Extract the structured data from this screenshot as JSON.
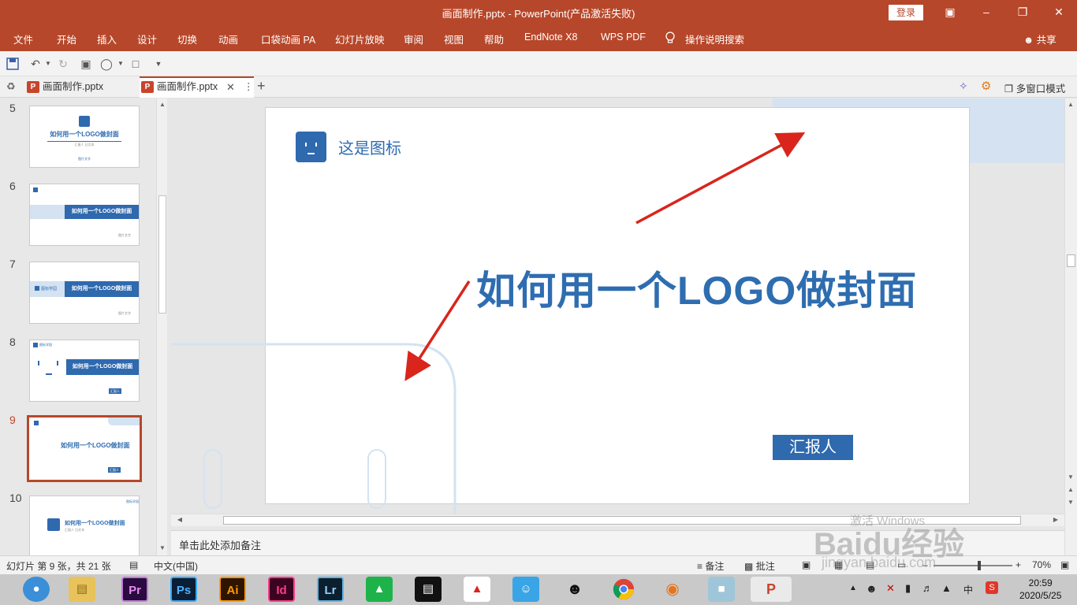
{
  "window": {
    "title": "画面制作.pptx  -  PowerPoint(产品激活失败)",
    "login": "登录"
  },
  "ribbon": {
    "tabs": [
      "文件",
      "开始",
      "插入",
      "设计",
      "切换",
      "动画",
      "口袋动画 PA",
      "幻灯片放映",
      "审阅",
      "视图",
      "帮助",
      "EndNote X8",
      "WPS PDF"
    ],
    "search": "操作说明搜索",
    "share": "共享"
  },
  "doc_tabs": {
    "tab1": "画面制作.pptx",
    "tab2": "画面制作.pptx",
    "multi_window": "多窗口模式"
  },
  "thumbnails": [
    {
      "num": "5",
      "title": "如何用一个LOGO做封面",
      "sub": "汇报人  日文本",
      "foot": "图片文字"
    },
    {
      "num": "6",
      "title": "如何用一个LOGO做封面",
      "sub": "",
      "foot": "图片文字"
    },
    {
      "num": "7",
      "title": "如何用一个LOGO做封面",
      "sub": "图标学园",
      "foot": "图片文字"
    },
    {
      "num": "8",
      "title": "如何用一个LOGO做封面",
      "sub": "图标学园",
      "foot": "汇报人"
    },
    {
      "num": "9",
      "title": "如何用一个LOGO做封面",
      "sub": "",
      "foot": "汇报人"
    },
    {
      "num": "10",
      "title": "如何用一个LOGO做封面",
      "sub": "汇报人  日文本",
      "foot": "图标学园"
    }
  ],
  "slide": {
    "logo_label": "这是图标",
    "title": "如何用一个LOGO做封面",
    "reporter": "汇报人"
  },
  "notes": "单击此处添加备注",
  "status": {
    "slide_info": "幻灯片 第 9 张，共 21 张",
    "language": "中文(中国)",
    "notes_btn": "备注",
    "comments_btn": "批注",
    "zoom": "70%"
  },
  "taskbar": {
    "apps": [
      "browser",
      "explorer",
      "Pr",
      "Ps",
      "Ai",
      "Id",
      "Lr",
      "app",
      "video",
      "app2",
      "app3",
      "qq",
      "chrome",
      "app4",
      "app5",
      "powerpoint"
    ],
    "time": "20:59",
    "date": "2020/5/25"
  },
  "watermark": {
    "activate": "激活 Windows",
    "brand": "Baidu经验",
    "url": "jingyan.baidu.com"
  },
  "colors": {
    "accent": "#b7472a",
    "slide_blue": "#2e6db0",
    "arrow": "#d9251c"
  }
}
